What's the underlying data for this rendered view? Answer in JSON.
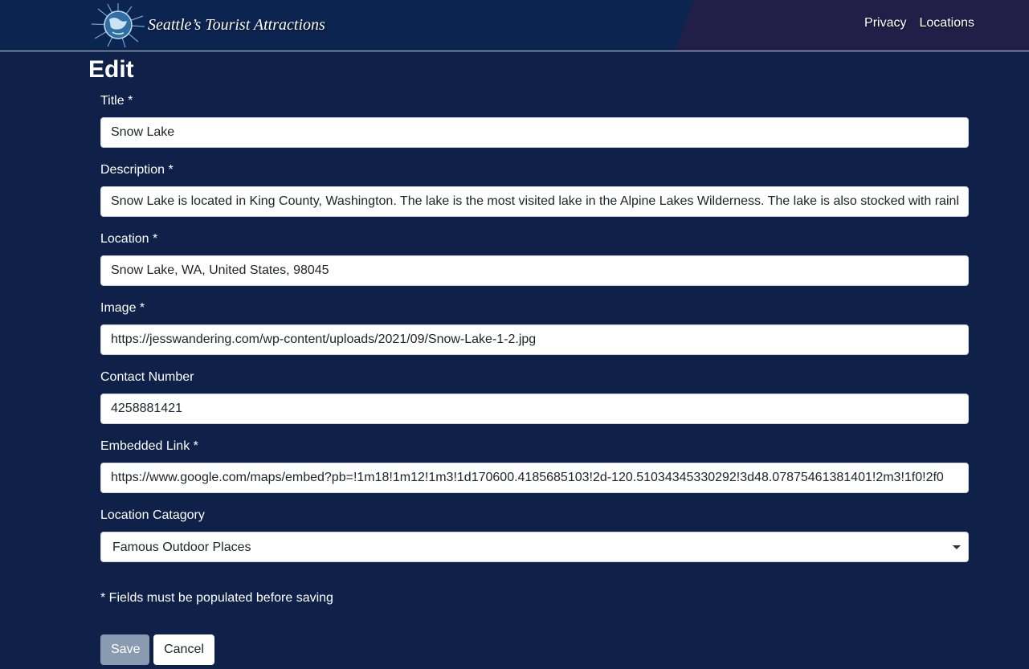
{
  "navbar": {
    "brand_title": "Seattle’s Tourist Attractions",
    "logo_icon": "globe-logo-icon",
    "links": [
      {
        "label": "Privacy"
      },
      {
        "label": "Locations"
      }
    ]
  },
  "page": {
    "title": "Edit"
  },
  "form": {
    "fields": [
      {
        "label": "Title *",
        "value": "Snow Lake"
      },
      {
        "label": "Description *",
        "value": "Snow Lake is located in King County, Washington. The lake is the most visited lake in the Alpine Lakes Wilderness. The lake is also stocked with rainbow trout."
      },
      {
        "label": "Location *",
        "value": "Snow Lake, WA, United States, 98045"
      },
      {
        "label": "Image *",
        "value": "https://jesswandering.com/wp-content/uploads/2021/09/Snow-Lake-1-2.jpg"
      },
      {
        "label": "Contact Number",
        "value": "4258881421"
      },
      {
        "label": "Embedded Link *",
        "value": "https://www.google.com/maps/embed?pb=!1m18!1m12!1m3!1d170600.4185685103!2d-120.51034345330292!3d48.07875461381401!2m3!1f0!2f0"
      }
    ],
    "category": {
      "label": "Location Catagory",
      "selected": "Famous Outdoor Places"
    },
    "required_note": "* Fields must be populated before saving",
    "save_label": "Save",
    "cancel_label": "Cancel"
  },
  "colors": {
    "page_background": "#0f2148",
    "navbar_background": "#0c2450",
    "save_button": "#8a9ab0"
  }
}
